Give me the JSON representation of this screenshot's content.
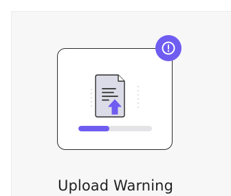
{
  "card": {
    "title": "Upload Warning"
  },
  "badge": {
    "icon": "exclamation-icon",
    "color": "#6f5cf1"
  },
  "illustration": {
    "icon": "document-upload-icon"
  },
  "progress": {
    "value": 0.42,
    "fill_color": "#6f5cf1",
    "track_color": "#e4e4e7"
  }
}
